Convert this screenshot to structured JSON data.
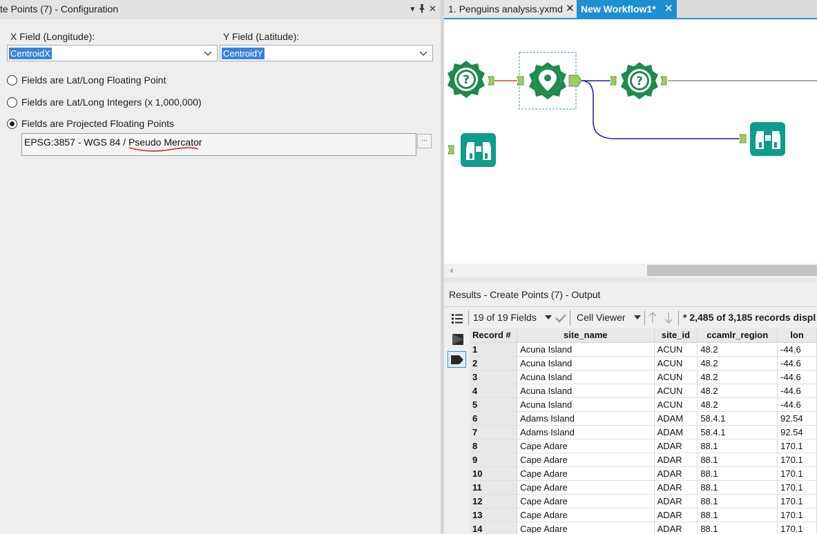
{
  "config": {
    "title": "te Points (7) - Configuration",
    "controls": {
      "dropdown": "▾",
      "pin": "📌",
      "close": "✕"
    },
    "x_field": {
      "label": "X Field (Longitude):",
      "value": "CentroidX"
    },
    "y_field": {
      "label": "Y Field (Latitude):",
      "value": "CentroidY"
    },
    "options": [
      {
        "label": "Fields are Lat/Long Floating Point",
        "selected": false
      },
      {
        "label": "Fields are Lat/Long Integers (x 1,000,000)",
        "selected": false
      },
      {
        "label": "Fields are Projected Floating Points",
        "selected": true
      }
    ],
    "projection": "EPSG:3857 - WGS 84 / Pseudo Mercator",
    "projection_button": "..."
  },
  "tabs": [
    {
      "label": "1. Penguins analysis.yxmd",
      "active": false,
      "close": "✕"
    },
    {
      "label": "New Workflow1*",
      "active": true,
      "close": "✕"
    }
  ],
  "canvas": {
    "tools": [
      {
        "name": "question-tool",
        "icon": "question-icon",
        "color": "#1f8a4c"
      },
      {
        "name": "create-points-tool",
        "icon": "location-pin-icon",
        "color": "#1f8a4c"
      },
      {
        "name": "question-tool-2",
        "icon": "question-icon",
        "color": "#1f8a4c"
      },
      {
        "name": "browse-tool",
        "icon": "binoculars-icon",
        "color": "#0f9c8a"
      },
      {
        "name": "browse-tool-2",
        "icon": "binoculars-icon",
        "color": "#0f9c8a"
      }
    ],
    "scroll_left": "‹"
  },
  "results": {
    "title": "Results - Create Points (7) - Output",
    "fields_selector": "19 of 19 Fields",
    "cell_viewer": "Cell Viewer",
    "record_summary": "* 2,485 of 3,185 records displ",
    "columns": [
      "Record #",
      "site_name",
      "site_id",
      "ccamlr_region",
      "lon"
    ],
    "rows": [
      [
        "1",
        "Acuna Island",
        "ACUN",
        "48.2",
        "-44.6"
      ],
      [
        "2",
        "Acuna Island",
        "ACUN",
        "48.2",
        "-44.6"
      ],
      [
        "3",
        "Acuna Island",
        "ACUN",
        "48.2",
        "-44.6"
      ],
      [
        "4",
        "Acuna Island",
        "ACUN",
        "48.2",
        "-44.6"
      ],
      [
        "5",
        "Acuna Island",
        "ACUN",
        "48.2",
        "-44.6"
      ],
      [
        "6",
        "Adams Island",
        "ADAM",
        "58.4.1",
        "92.54"
      ],
      [
        "7",
        "Adams Island",
        "ADAM",
        "58.4.1",
        "92.54"
      ],
      [
        "8",
        "Cape Adare",
        "ADAR",
        "88.1",
        "170.1"
      ],
      [
        "9",
        "Cape Adare",
        "ADAR",
        "88.1",
        "170.1"
      ],
      [
        "10",
        "Cape Adare",
        "ADAR",
        "88.1",
        "170.1"
      ],
      [
        "11",
        "Cape Adare",
        "ADAR",
        "88.1",
        "170.1"
      ],
      [
        "12",
        "Cape Adare",
        "ADAR",
        "88.1",
        "170.1"
      ],
      [
        "13",
        "Cape Adare",
        "ADAR",
        "88.1",
        "170.1"
      ],
      [
        "14",
        "Cape Adare",
        "ADAR",
        "88.1",
        "170.1"
      ]
    ]
  }
}
